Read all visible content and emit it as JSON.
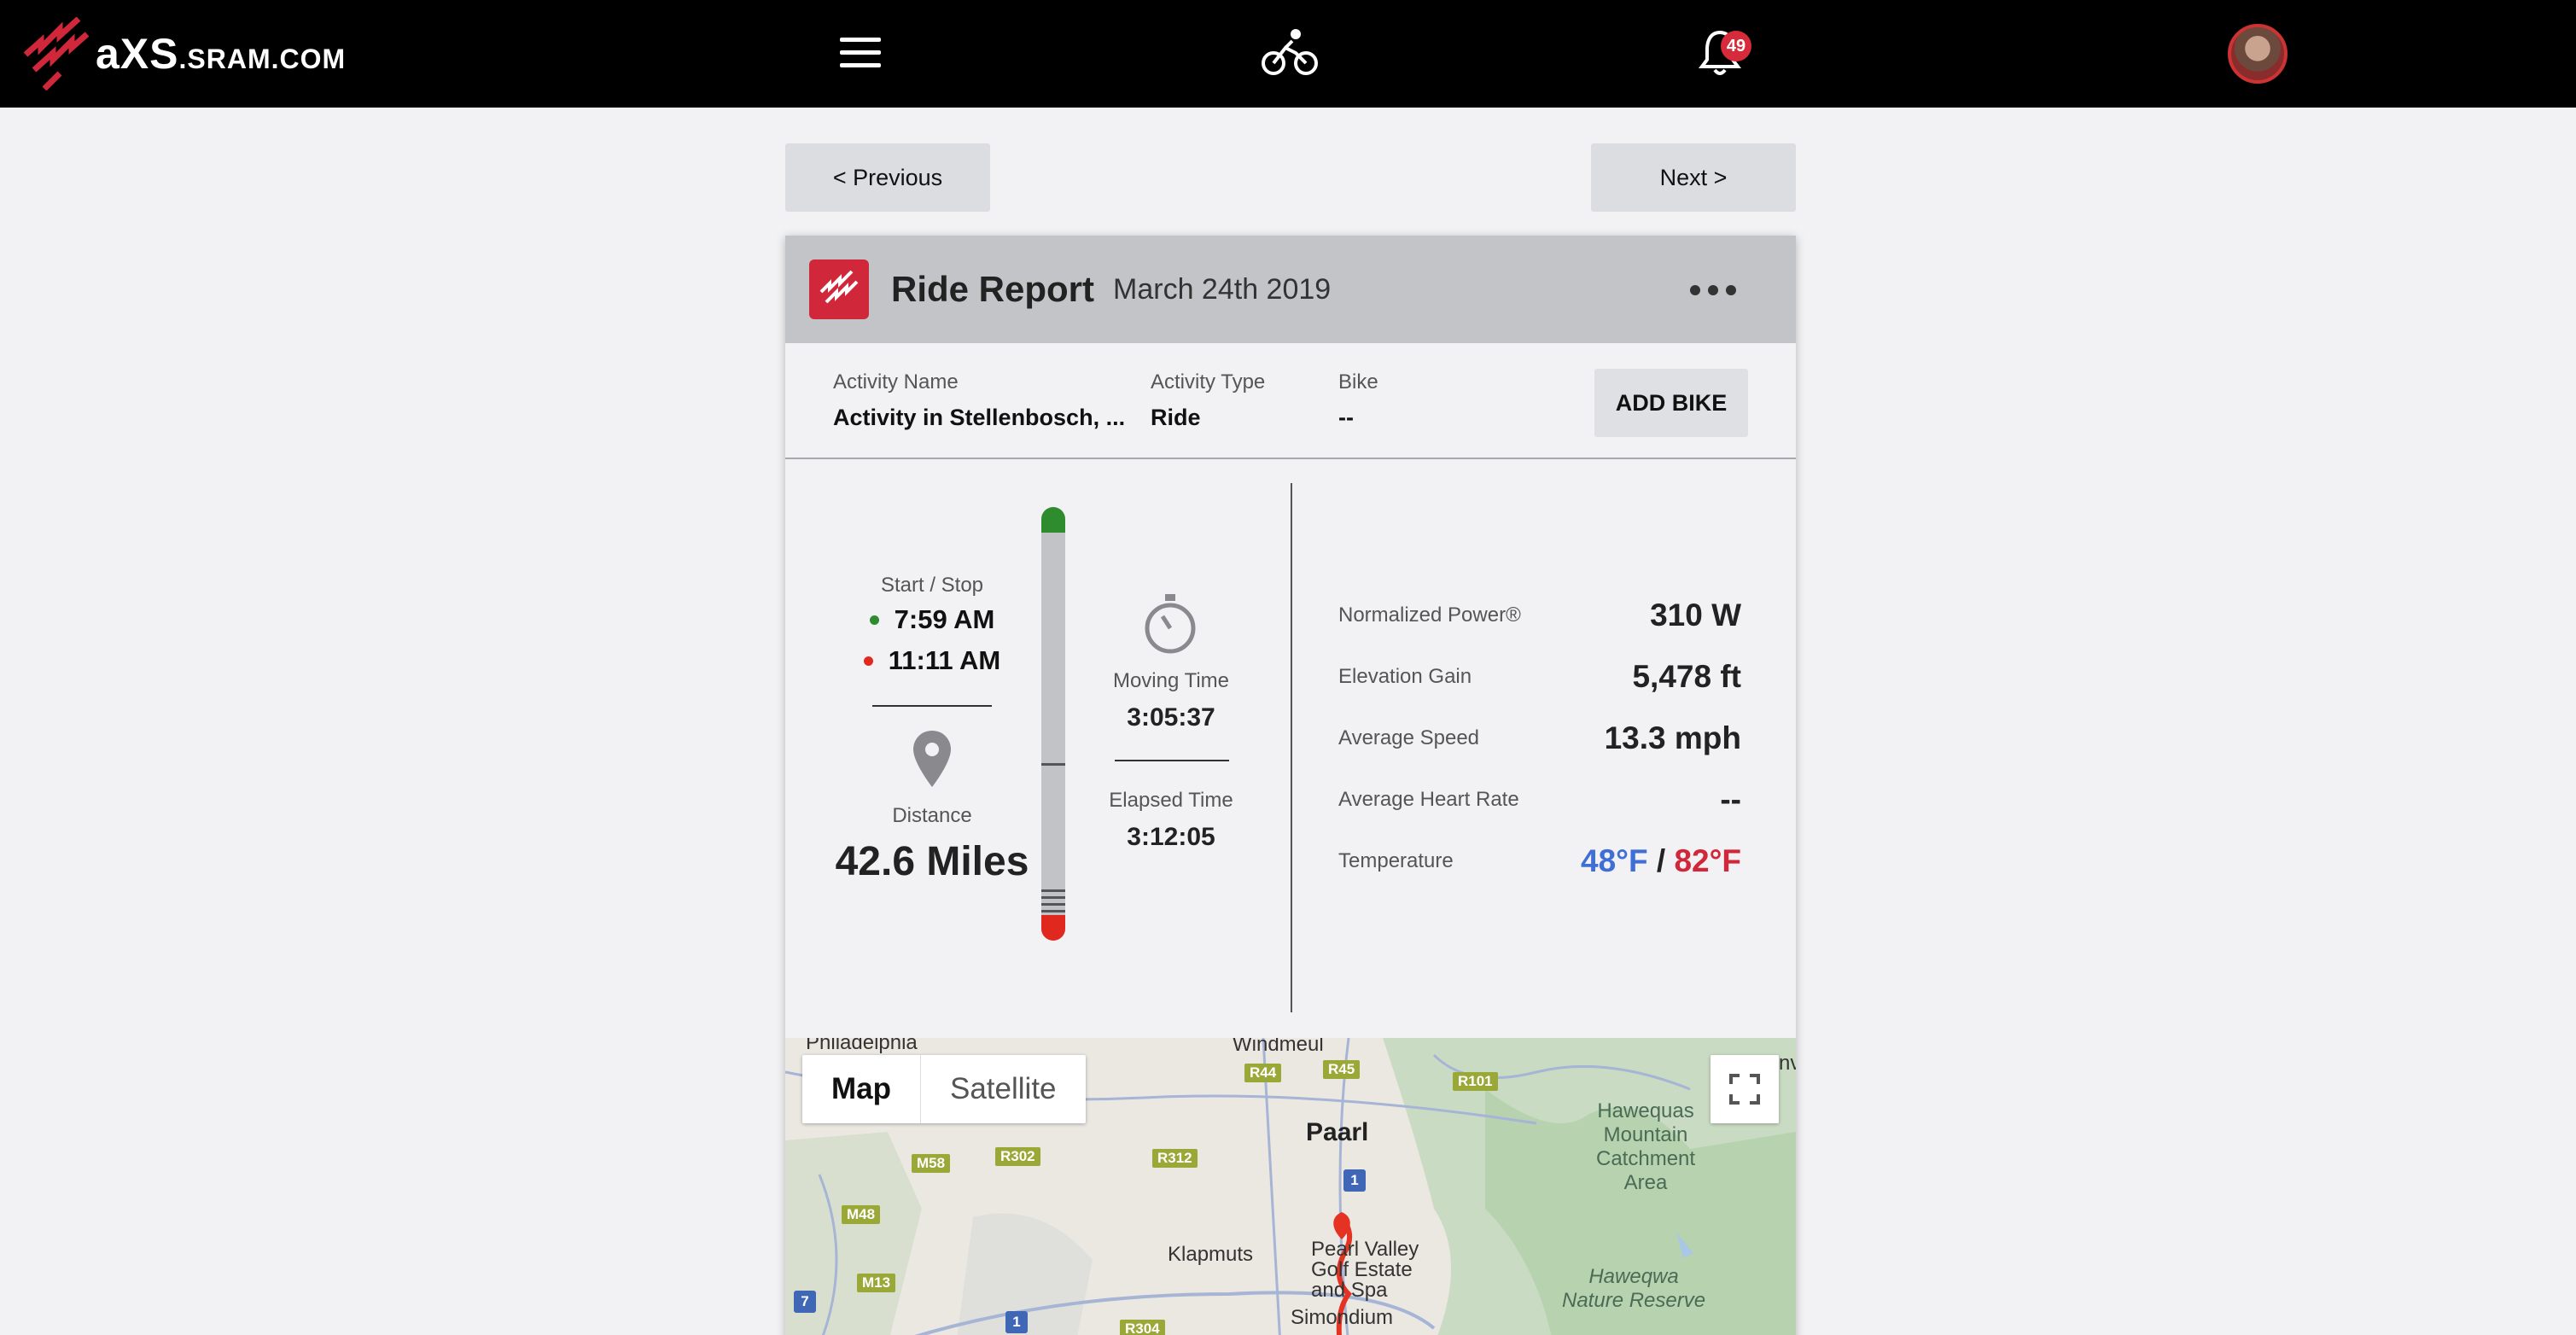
{
  "header": {
    "brand": "aXS",
    "brand_domain": ".SRAM.COM",
    "notification_count": "49",
    "icons": [
      "sram-logo-icon",
      "menu-icon",
      "bike-icon",
      "bell-icon",
      "avatar"
    ]
  },
  "nav": {
    "previous_label": "< Previous",
    "next_label": "Next >"
  },
  "report": {
    "title": "Ride Report",
    "date": "March 24th 2019",
    "activity_name_label": "Activity Name",
    "activity_name": "Activity in Stellenbosch, ...",
    "activity_type_label": "Activity Type",
    "activity_type": "Ride",
    "bike_label": "Bike",
    "bike": "--",
    "add_bike_label": "ADD BIKE",
    "start_stop_label": "Start / Stop",
    "start_time": "7:59 AM",
    "stop_time": "11:11 AM",
    "distance_label": "Distance",
    "distance": "42.6 Miles",
    "moving_time_label": "Moving Time",
    "moving_time": "3:05:37",
    "elapsed_time_label": "Elapsed Time",
    "elapsed_time": "3:12:05",
    "metrics": [
      {
        "label": "Normalized Power®",
        "value": "310 W"
      },
      {
        "label": "Elevation Gain",
        "value": "5,478 ft"
      },
      {
        "label": "Average Speed",
        "value": "13.3 mph"
      },
      {
        "label": "Average Heart Rate",
        "value": "--"
      }
    ],
    "temperature_label": "Temperature",
    "temp_low": "48°F",
    "temp_sep": "/",
    "temp_high": "82°F",
    "colors": {
      "accent": "#d0283a",
      "start": "#2e8b2e",
      "stop": "#e0281e",
      "cold": "#3f6fd6"
    }
  },
  "map": {
    "map_label": "Map",
    "satellite_label": "Satellite",
    "places": {
      "philadelphia": "Philadelphia",
      "windmeul": "Windmeul",
      "paarl": "Paarl",
      "klapmuts": "Klapmuts",
      "pearl_valley": "Pearl Valley\nGolf Estate\nand Spa",
      "simondium": "Simondium",
      "hawequas": "Hawequas\nMountain\nCatchment\nArea",
      "haweqwa": "Haweqwa\nNature Reserve",
      "edge_nv": "nv"
    },
    "routes": [
      "R44",
      "R45",
      "R101",
      "M58",
      "R302",
      "R312",
      "M48",
      "M13",
      "R304",
      "1",
      "7"
    ]
  }
}
